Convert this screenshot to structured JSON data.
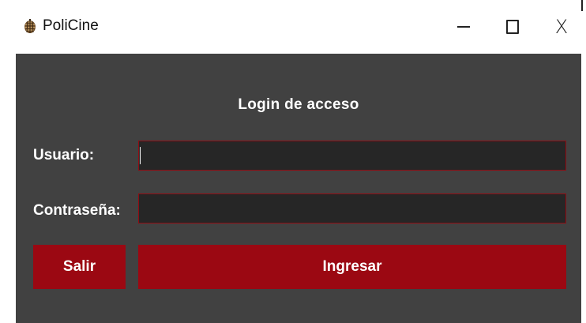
{
  "window": {
    "title": "PoliCine",
    "app_icon": "pinecone-icon",
    "controls": {
      "minimize": "minimize-icon",
      "maximize": "maximize-icon",
      "close_glyph": "X"
    }
  },
  "login": {
    "heading": "Login de acceso",
    "username_label": "Usuario:",
    "username_value": "",
    "password_label": "Contraseña:",
    "password_value": "",
    "exit_label": "Salir",
    "submit_label": "Ingresar"
  },
  "colors": {
    "background": "#414141",
    "field_bg": "#262626",
    "accent": "#9b0812"
  }
}
